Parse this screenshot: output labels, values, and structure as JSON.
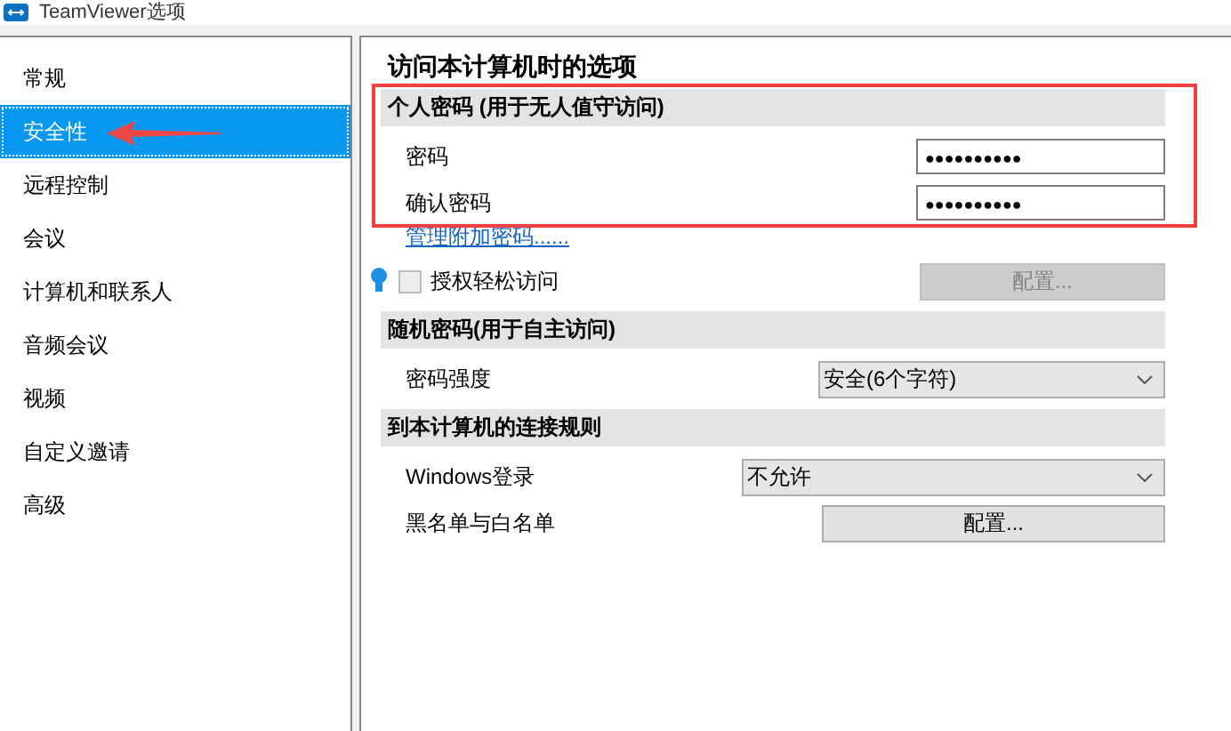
{
  "window": {
    "title": "TeamViewer选项"
  },
  "sidebar": {
    "items": [
      {
        "label": "常规",
        "selected": false
      },
      {
        "label": "安全性",
        "selected": true
      },
      {
        "label": "远程控制",
        "selected": false
      },
      {
        "label": "会议",
        "selected": false
      },
      {
        "label": "计算机和联系人",
        "selected": false
      },
      {
        "label": "音频会议",
        "selected": false
      },
      {
        "label": "视频",
        "selected": false
      },
      {
        "label": "自定义邀请",
        "selected": false
      },
      {
        "label": "高级",
        "selected": false
      }
    ]
  },
  "page_title": "访问本计算机时的选项",
  "sections": [
    {
      "header": "个人密码 (用于无人值守访问)",
      "rows": [
        {
          "kind": "password",
          "label": "密码",
          "value": "●●●●●●●●●●"
        },
        {
          "kind": "password",
          "label": "确认密码",
          "value": "●●●●●●●●●●"
        },
        {
          "kind": "link",
          "label": "管理附加密码......"
        },
        {
          "kind": "checkbox",
          "label": "授权轻松访问",
          "checked": false,
          "button": "配置...",
          "disabled": true
        }
      ]
    },
    {
      "header": "随机密码(用于自主访问)",
      "rows": [
        {
          "kind": "dropdown",
          "label": "密码强度",
          "value": "安全(6个字符)"
        }
      ]
    },
    {
      "header": "到本计算机的连接规则",
      "rows": [
        {
          "kind": "dropdown",
          "label": "Windows登录",
          "value": "不允许"
        },
        {
          "kind": "button",
          "label": "黑名单与白名单",
          "button": "配置..."
        }
      ]
    }
  ]
}
